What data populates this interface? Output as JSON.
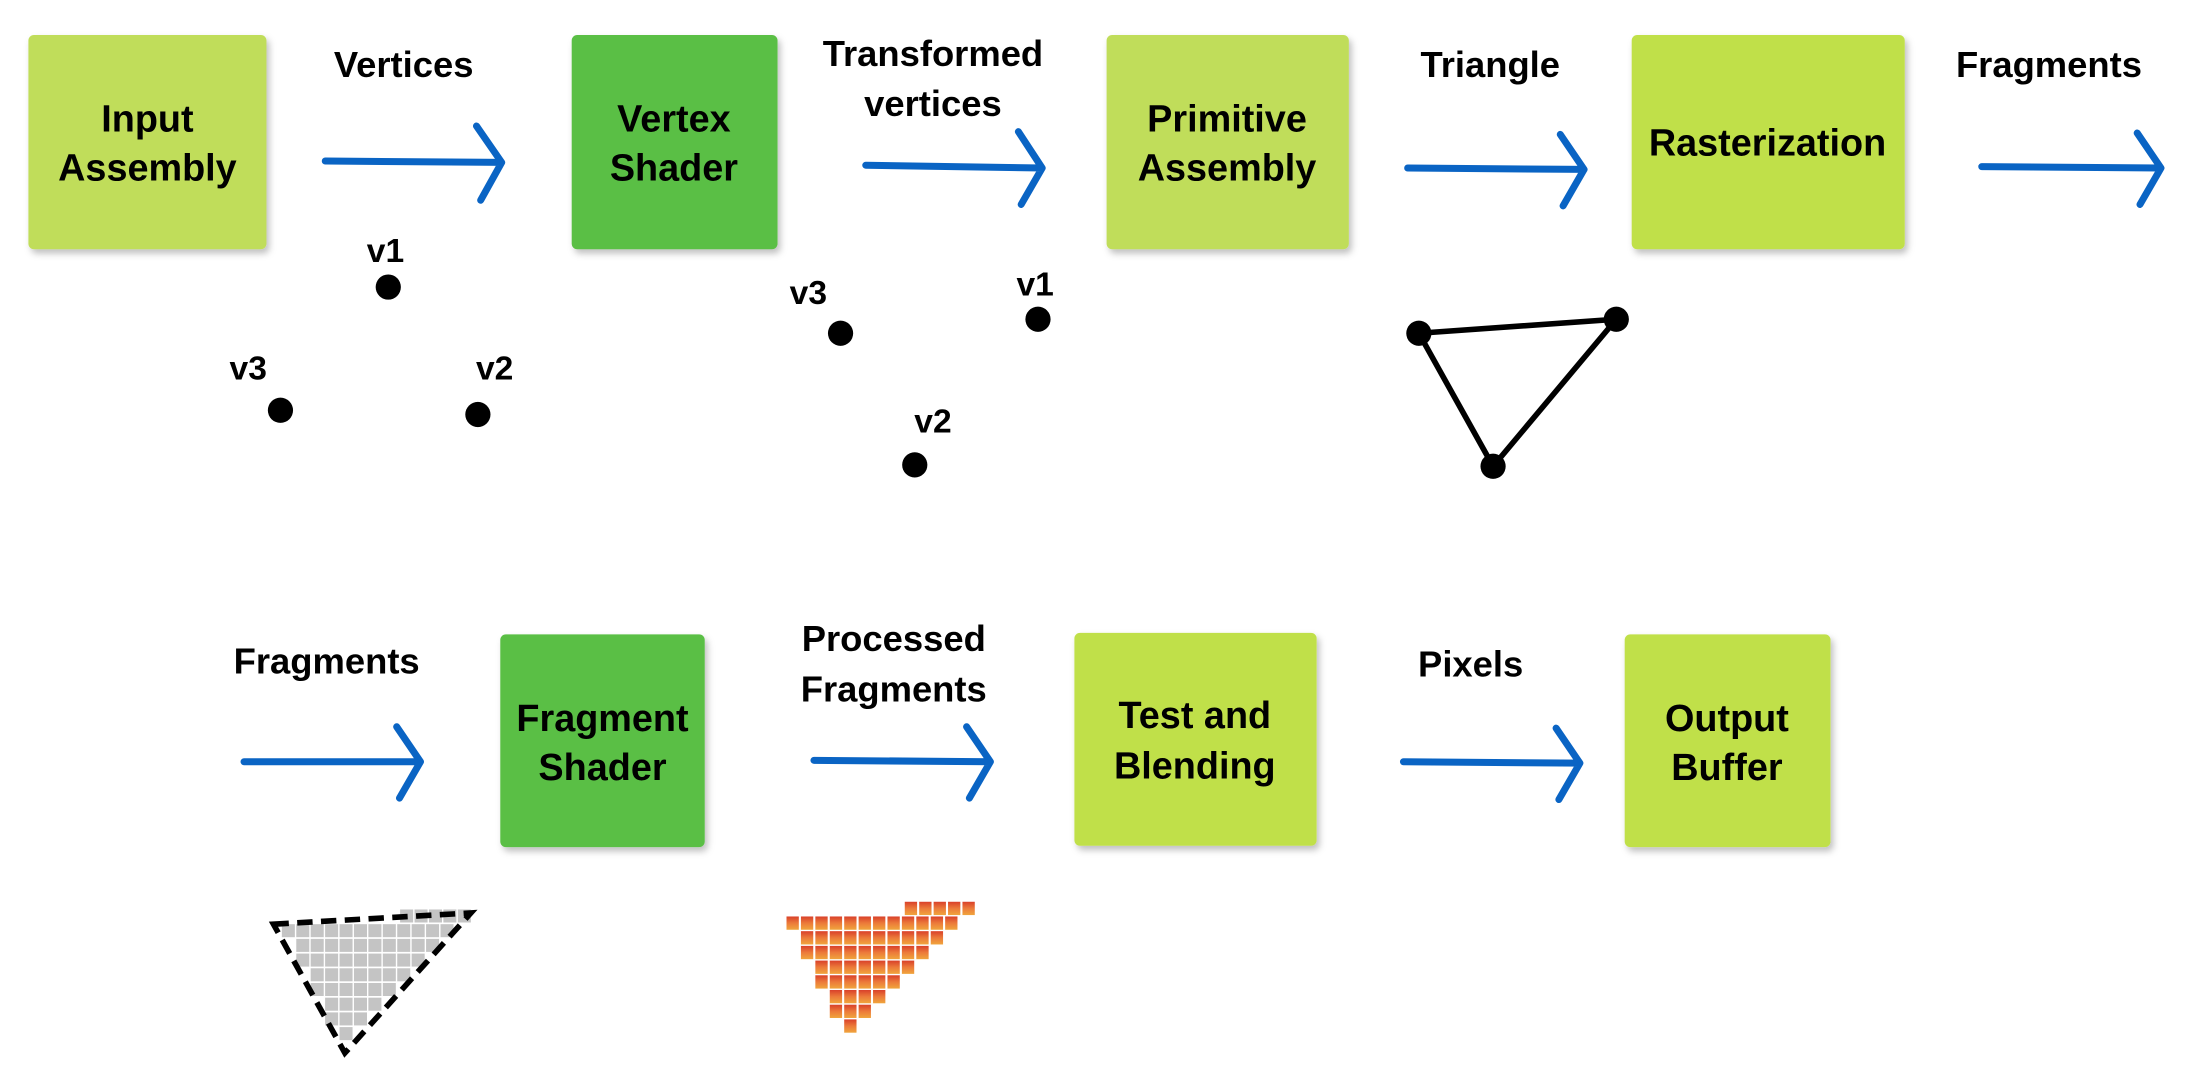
{
  "colors": {
    "stage_light": "#c0dd5a",
    "stage_lime": "#c0e04a",
    "stage_shader": "#5abf44",
    "arrow": "#0a64c4",
    "fragment_cell": "#c4c4c4",
    "processed_top": "#d9402a",
    "processed_bottom": "#f0a53c"
  },
  "stages": [
    {
      "lines": [
        "Input",
        "Assembly"
      ]
    },
    {
      "lines": [
        "Vertex",
        "Shader"
      ]
    },
    {
      "lines": [
        "Primitive",
        "Assembly"
      ]
    },
    {
      "lines": [
        "Rasterization"
      ]
    },
    {
      "lines": [
        "Fragment",
        "Shader"
      ]
    },
    {
      "lines": [
        "Test and",
        "Blending"
      ]
    },
    {
      "lines": [
        "Output",
        "Buffer"
      ]
    }
  ],
  "arrows": [
    {
      "lines": [
        "Vertices"
      ]
    },
    {
      "lines": [
        "Transformed",
        "vertices"
      ]
    },
    {
      "lines": [
        "Triangle"
      ]
    },
    {
      "lines": [
        "Fragments"
      ]
    },
    {
      "lines": [
        "Fragments"
      ]
    },
    {
      "lines": [
        "Processed",
        "Fragments"
      ]
    },
    {
      "lines": [
        "Pixels"
      ]
    }
  ],
  "vertices_input": {
    "v1": "v1",
    "v2": "v2",
    "v3": "v3"
  },
  "vertices_transformed": {
    "v1": "v1",
    "v2": "v2",
    "v3": "v3"
  }
}
